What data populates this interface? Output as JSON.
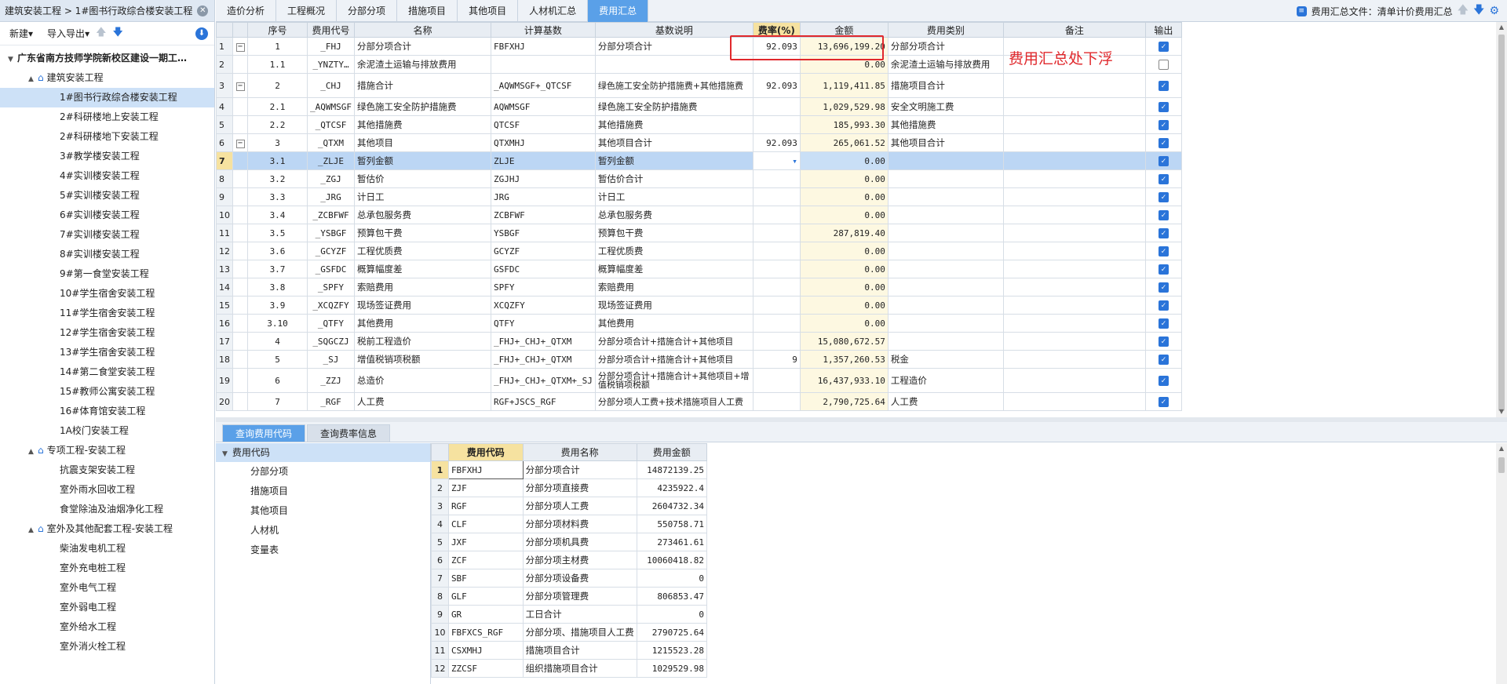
{
  "left": {
    "breadcrumb": "建筑安装工程 > 1#图书行政综合楼安装工程",
    "new_label": "新建",
    "import_export_label": "导入导出",
    "tree": [
      {
        "label": "广东省南方技师学院新校区建设一期工…",
        "level": 0,
        "bold": true,
        "expand": "▼",
        "home": false
      },
      {
        "label": "建筑安装工程",
        "level": 1,
        "expand": "▲",
        "home": true
      },
      {
        "label": "1#图书行政综合楼安装工程",
        "level": 2,
        "selected": true
      },
      {
        "label": "2#科研楼地上安装工程",
        "level": 2
      },
      {
        "label": "2#科研楼地下安装工程",
        "level": 2
      },
      {
        "label": "3#教学楼安装工程",
        "level": 2
      },
      {
        "label": "4#实训楼安装工程",
        "level": 2
      },
      {
        "label": "5#实训楼安装工程",
        "level": 2
      },
      {
        "label": "6#实训楼安装工程",
        "level": 2
      },
      {
        "label": "7#实训楼安装工程",
        "level": 2
      },
      {
        "label": "8#实训楼安装工程",
        "level": 2
      },
      {
        "label": "9#第一食堂安装工程",
        "level": 2
      },
      {
        "label": "10#学生宿舍安装工程",
        "level": 2
      },
      {
        "label": "11#学生宿舍安装工程",
        "level": 2
      },
      {
        "label": "12#学生宿舍安装工程",
        "level": 2
      },
      {
        "label": "13#学生宿舍安装工程",
        "level": 2
      },
      {
        "label": "14#第二食堂安装工程",
        "level": 2
      },
      {
        "label": "15#教师公寓安装工程",
        "level": 2
      },
      {
        "label": "16#体育馆安装工程",
        "level": 2
      },
      {
        "label": "1A校门安装工程",
        "level": 2
      },
      {
        "label": "专项工程-安装工程",
        "level": 1,
        "expand": "▲",
        "home": true
      },
      {
        "label": "抗震支架安装工程",
        "level": 2
      },
      {
        "label": "室外雨水回收工程",
        "level": 2
      },
      {
        "label": "食堂除油及油烟净化工程",
        "level": 2
      },
      {
        "label": "室外及其他配套工程-安装工程",
        "level": 1,
        "expand": "▲",
        "home": true
      },
      {
        "label": "柴油发电机工程",
        "level": 2
      },
      {
        "label": "室外充电桩工程",
        "level": 2
      },
      {
        "label": "室外电气工程",
        "level": 2
      },
      {
        "label": "室外弱电工程",
        "level": 2
      },
      {
        "label": "室外给水工程",
        "level": 2
      },
      {
        "label": "室外消火栓工程",
        "level": 2
      }
    ]
  },
  "tabs": [
    "造价分析",
    "工程概况",
    "分部分项",
    "措施项目",
    "其他项目",
    "人材机汇总",
    "费用汇总"
  ],
  "active_tab": 6,
  "fee_file_label": "费用汇总文件：清单计价费用汇总",
  "grid": {
    "headers": [
      "",
      "",
      "序号",
      "费用代号",
      "名称",
      "计算基数",
      "基数说明",
      "费率(%)",
      "金额",
      "费用类别",
      "备注",
      "输出"
    ],
    "rows": [
      {
        "rn": "1",
        "fold": "−",
        "seq": "1",
        "code": "_FHJ",
        "name": "分部分项合计",
        "base": "FBFXHJ",
        "desc": "分部分项合计",
        "rate": "92.093",
        "amt": "13,696,199.20",
        "cat": "分部分项合计",
        "out": true
      },
      {
        "rn": "2",
        "fold": "",
        "seq": "1.1",
        "code": "_YNZTY…",
        "name": "余泥渣土运输与排放费用",
        "base": "",
        "desc": "",
        "rate": "",
        "amt": "0.00",
        "cat": "余泥渣土运输与排放费用",
        "out": false
      },
      {
        "rn": "3",
        "fold": "−",
        "seq": "2",
        "code": "_CHJ",
        "name": "措施合计",
        "base": "_AQWMSGF+_QTCSF",
        "desc": "绿色施工安全防护措施费+其他措施费",
        "rate": "92.093",
        "amt": "1,119,411.85",
        "cat": "措施项目合计",
        "out": true,
        "tall": true
      },
      {
        "rn": "4",
        "fold": "",
        "seq": "2.1",
        "code": "_AQWMSGF",
        "name": "绿色施工安全防护措施费",
        "base": "AQWMSGF",
        "desc": "绿色施工安全防护措施费",
        "rate": "",
        "amt": "1,029,529.98",
        "cat": "安全文明施工费",
        "out": true
      },
      {
        "rn": "5",
        "fold": "",
        "seq": "2.2",
        "code": "_QTCSF",
        "name": "其他措施费",
        "base": "QTCSF",
        "desc": "其他措施费",
        "rate": "",
        "amt": "185,993.30",
        "cat": "其他措施费",
        "out": true
      },
      {
        "rn": "6",
        "fold": "−",
        "seq": "3",
        "code": "_QTXM",
        "name": "其他项目",
        "base": "QTXMHJ",
        "desc": "其他项目合计",
        "rate": "92.093",
        "amt": "265,061.52",
        "cat": "其他项目合计",
        "out": true
      },
      {
        "rn": "7",
        "fold": "",
        "seq": "3.1",
        "code": "_ZLJE",
        "name": "暂列金额",
        "base": "ZLJE",
        "desc": "暂列金额",
        "rate": "",
        "amt": "0.00",
        "cat": "",
        "out": true,
        "sel": true
      },
      {
        "rn": "8",
        "fold": "",
        "seq": "3.2",
        "code": "_ZGJ",
        "name": "暂估价",
        "base": "ZGJHJ",
        "desc": "暂估价合计",
        "rate": "",
        "amt": "0.00",
        "cat": "",
        "out": true
      },
      {
        "rn": "9",
        "fold": "",
        "seq": "3.3",
        "code": "_JRG",
        "name": "计日工",
        "base": "JRG",
        "desc": "计日工",
        "rate": "",
        "amt": "0.00",
        "cat": "",
        "out": true
      },
      {
        "rn": "10",
        "fold": "",
        "seq": "3.4",
        "code": "_ZCBFWF",
        "name": "总承包服务费",
        "base": "ZCBFWF",
        "desc": "总承包服务费",
        "rate": "",
        "amt": "0.00",
        "cat": "",
        "out": true
      },
      {
        "rn": "11",
        "fold": "",
        "seq": "3.5",
        "code": "_YSBGF",
        "name": "预算包干费",
        "base": "YSBGF",
        "desc": "预算包干费",
        "rate": "",
        "amt": "287,819.40",
        "cat": "",
        "out": true
      },
      {
        "rn": "12",
        "fold": "",
        "seq": "3.6",
        "code": "_GCYZF",
        "name": "工程优质费",
        "base": "GCYZF",
        "desc": "工程优质费",
        "rate": "",
        "amt": "0.00",
        "cat": "",
        "out": true
      },
      {
        "rn": "13",
        "fold": "",
        "seq": "3.7",
        "code": "_GSFDC",
        "name": "概算幅度差",
        "base": "GSFDC",
        "desc": "概算幅度差",
        "rate": "",
        "amt": "0.00",
        "cat": "",
        "out": true
      },
      {
        "rn": "14",
        "fold": "",
        "seq": "3.8",
        "code": "_SPFY",
        "name": "索赔费用",
        "base": "SPFY",
        "desc": "索赔费用",
        "rate": "",
        "amt": "0.00",
        "cat": "",
        "out": true
      },
      {
        "rn": "15",
        "fold": "",
        "seq": "3.9",
        "code": "_XCQZFY",
        "name": "现场签证费用",
        "base": "XCQZFY",
        "desc": "现场签证费用",
        "rate": "",
        "amt": "0.00",
        "cat": "",
        "out": true
      },
      {
        "rn": "16",
        "fold": "",
        "seq": "3.10",
        "code": "_QTFY",
        "name": "其他费用",
        "base": "QTFY",
        "desc": "其他费用",
        "rate": "",
        "amt": "0.00",
        "cat": "",
        "out": true
      },
      {
        "rn": "17",
        "fold": "",
        "seq": "4",
        "code": "_SQGCZJ",
        "name": "税前工程造价",
        "base": "_FHJ+_CHJ+_QTXM",
        "desc": "分部分项合计+措施合计+其他项目",
        "rate": "",
        "amt": "15,080,672.57",
        "cat": "",
        "out": true
      },
      {
        "rn": "18",
        "fold": "",
        "seq": "5",
        "code": "_SJ",
        "name": "增值税销项税额",
        "base": "_FHJ+_CHJ+_QTXM",
        "desc": "分部分项合计+措施合计+其他项目",
        "rate": "9",
        "amt": "1,357,260.53",
        "cat": "税金",
        "out": true
      },
      {
        "rn": "19",
        "fold": "",
        "seq": "6",
        "code": "_ZZJ",
        "name": "总造价",
        "base": "_FHJ+_CHJ+_QTXM+_SJ",
        "desc": "分部分项合计+措施合计+其他项目+增值税销项税额",
        "rate": "",
        "amt": "16,437,933.10",
        "cat": "工程造价",
        "out": true,
        "tall": true
      },
      {
        "rn": "20",
        "fold": "",
        "seq": "7",
        "code": "_RGF",
        "name": "人工费",
        "base": "RGF+JSCS_RGF",
        "desc": "分部分项人工费+技术措施项目人工费",
        "rate": "",
        "amt": "2,790,725.64",
        "cat": "人工费",
        "out": true
      }
    ]
  },
  "annotation": "费用汇总处下浮",
  "bottom": {
    "tabs": [
      "查询费用代码",
      "查询费率信息"
    ],
    "tree_root": "费用代码",
    "tree_children": [
      "分部分项",
      "措施项目",
      "其他项目",
      "人材机",
      "变量表"
    ],
    "headers": [
      "",
      "费用代码",
      "费用名称",
      "费用金额"
    ],
    "rows": [
      {
        "rn": "1",
        "code": "FBFXHJ",
        "name": "分部分项合计",
        "amt": "14872139.25"
      },
      {
        "rn": "2",
        "code": "ZJF",
        "name": "分部分项直接费",
        "amt": "4235922.4"
      },
      {
        "rn": "3",
        "code": "RGF",
        "name": "分部分项人工费",
        "amt": "2604732.34"
      },
      {
        "rn": "4",
        "code": "CLF",
        "name": "分部分项材料费",
        "amt": "550758.71"
      },
      {
        "rn": "5",
        "code": "JXF",
        "name": "分部分项机具费",
        "amt": "273461.61"
      },
      {
        "rn": "6",
        "code": "ZCF",
        "name": "分部分项主材费",
        "amt": "10060418.82"
      },
      {
        "rn": "7",
        "code": "SBF",
        "name": "分部分项设备费",
        "amt": "0"
      },
      {
        "rn": "8",
        "code": "GLF",
        "name": "分部分项管理费",
        "amt": "806853.47"
      },
      {
        "rn": "9",
        "code": "GR",
        "name": "工日合计",
        "amt": "0"
      },
      {
        "rn": "10",
        "code": "FBFXCS_RGF",
        "name": "分部分项、措施项目人工费",
        "amt": "2790725.64"
      },
      {
        "rn": "11",
        "code": "CSXMHJ",
        "name": "措施项目合计",
        "amt": "1215523.28"
      },
      {
        "rn": "12",
        "code": "ZZCSF",
        "name": "组织措施项目合计",
        "amt": "1029529.98"
      }
    ]
  },
  "colors": {
    "accent": "#5aa0e8",
    "highlight": "#f6e2a0",
    "selected": "#bcd6f4",
    "annotation": "#e0282c"
  }
}
